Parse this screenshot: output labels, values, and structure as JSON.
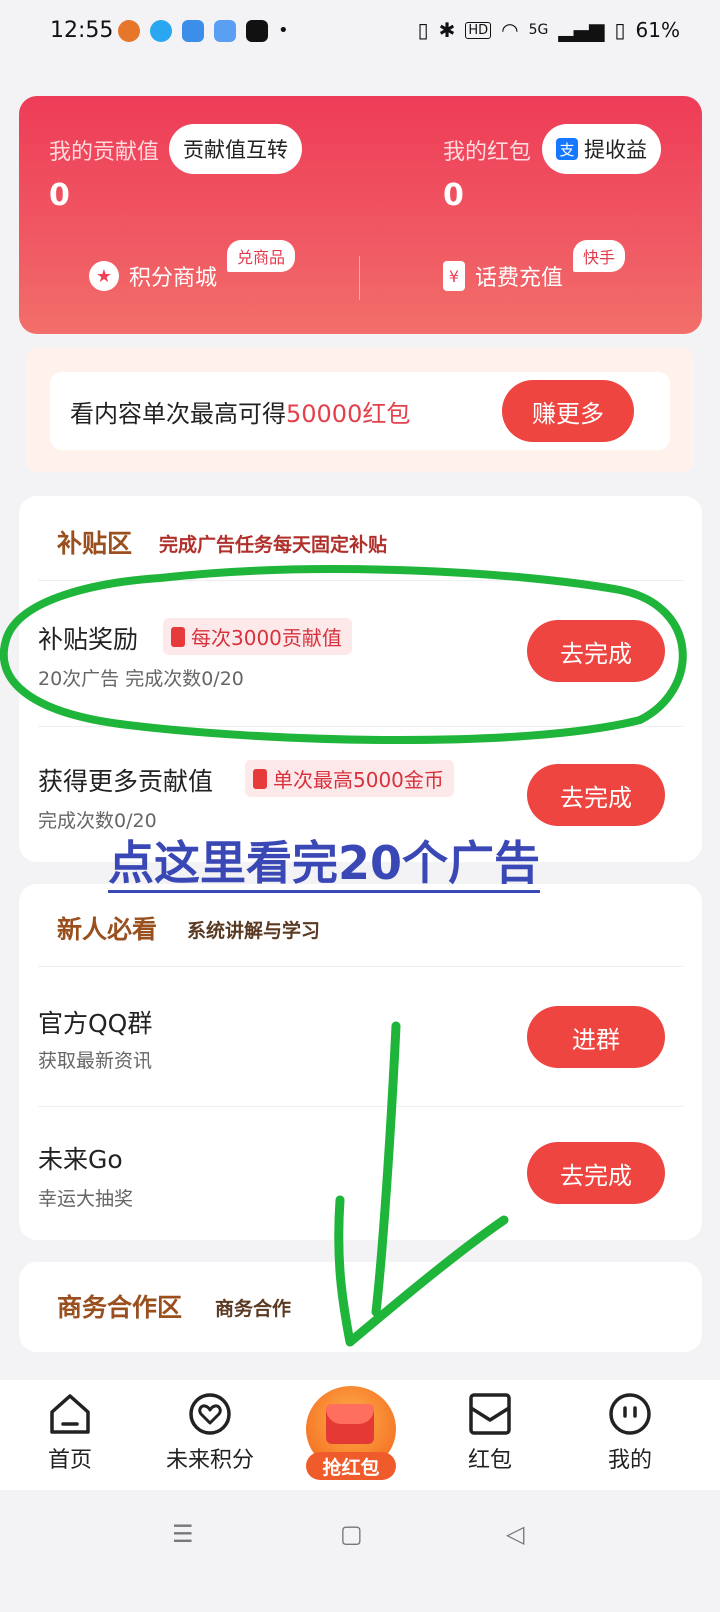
{
  "status_bar": {
    "time": "12:55",
    "dot": "•",
    "network": "HD",
    "signal": "5G",
    "battery": "61%"
  },
  "top_card": {
    "contribution_label": "我的贡献值",
    "transfer_button": "贡献值互转",
    "contribution_value": "0",
    "redpacket_label": "我的红包",
    "withdraw_button": "提收益",
    "redpacket_value": "0",
    "mall_label": "积分商城",
    "mall_badge": "兑商品",
    "recharge_label": "话费充值",
    "recharge_badge": "快手",
    "withdraw_icon_glyph": "支",
    "recharge_icon_glyph": "¥",
    "mall_icon_glyph": "★"
  },
  "banner": {
    "text_prefix": "看内容单次最高可得",
    "text_highlight": "50000红包",
    "button": "赚更多"
  },
  "subsidy": {
    "title": "补贴区",
    "subtitle": "完成广告任务每天固定补贴",
    "items": [
      {
        "title": "补贴奖励",
        "tag": "每次3000贡献值",
        "sub": "20次广告  完成次数0/20",
        "button": "去完成"
      },
      {
        "title": "获得更多贡献值",
        "tag": "单次最高5000金币",
        "sub": "完成次数0/20",
        "button": "去完成"
      }
    ]
  },
  "annotation": "点这里看完20个广告",
  "newbie": {
    "title": "新人必看",
    "subtitle": "系统讲解与学习",
    "items": [
      {
        "title": "官方QQ群",
        "sub": "获取最新资讯",
        "button": "进群"
      },
      {
        "title": "未来Go",
        "sub": "幸运大抽奖",
        "button": "去完成"
      }
    ]
  },
  "business": {
    "title": "商务合作区",
    "subtitle": "商务合作"
  },
  "tabs": {
    "home": "首页",
    "points": "未来积分",
    "grab": "抢红包",
    "redpacket": "红包",
    "mine": "我的"
  },
  "nav": {
    "menu": "☰",
    "home": "▢",
    "back": "◁"
  },
  "colors": {
    "accent_red": "#ee4540",
    "card_top": "#ee3c57",
    "annotation": "#3a48b6",
    "marker_green": "#1fb53a"
  }
}
